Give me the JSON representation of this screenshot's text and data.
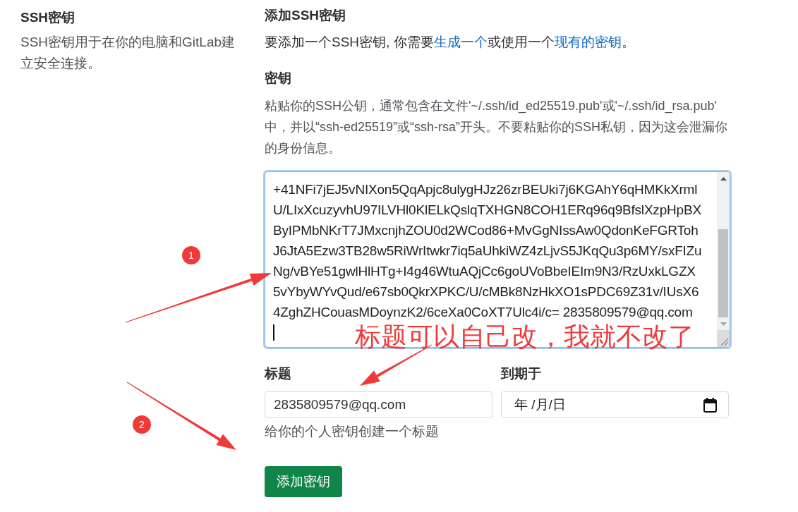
{
  "section": {
    "title": "SSH密钥",
    "description": "SSH密钥用于在你的电脑和GitLab建立安全连接。"
  },
  "form": {
    "title": "添加SSH密钥",
    "intro": [
      {
        "text": "要添加一个SSH密钥, 你需要",
        "kind": "text"
      },
      {
        "text": "生成一个",
        "kind": "link"
      },
      {
        "text": "或使用一个",
        "kind": "text"
      },
      {
        "text": "现有的密钥",
        "kind": "link"
      },
      {
        "text": "。",
        "kind": "text"
      }
    ],
    "key": {
      "label": "密钥",
      "help": "粘贴你的SSH公钥，通常包含在文件'~/.ssh/id_ed25519.pub'或'~/.ssh/id_rsa.pub' 中，并以“ssh-ed25519”或“ssh-rsa”开头。不要粘贴你的SSH私钥，因为这会泄漏你的身份信息。",
      "focused": true,
      "value_lines": [
        "+41NFi7jEJ5vNIXon5QqApjc8ulygHJz26zrBEUki7j6KGAhY6qHMKkXrml",
        "U/LIxXcuzyvhU97ILVHl0KlELkQslqTXHGN8COH1ERq96q9BfslXzpHpBX",
        "ByIPMbNKrT7JMxcnjhZOU0d2WCod86+MvGgNIssAw0QdonKeFGRToh",
        "J6JtA5Ezw3TB28w5RiWrItwkr7iq5aUhkiWZ4zLjvS5JKqQu3p6MY/sxFIZu",
        "Ng/vBYe51gwlHlHTg+I4g46WtuAQjCc6goUVoBbeIEIm9N3/RzUxkLGZX",
        "5vYbyWYvQud/e67sb0QkrXPKC/U/cMBk8NzHkXO1sPDC69Z31v/IUsX6",
        "4ZghZHCouasMDoynzK2/6ceXa0CoXT7Ulc4i/c= 2835809579@qq.com"
      ]
    },
    "title_field": {
      "label": "标题",
      "value": "2835809579@qq.com",
      "help": "给你的个人密钥创建一个标题"
    },
    "expires": {
      "label": "到期于",
      "placeholder": "年 /月/日"
    },
    "submit": "添加密钥"
  },
  "annotations": {
    "markers": [
      "1",
      "2"
    ],
    "note": "标题可以自己改，我就不改了"
  }
}
